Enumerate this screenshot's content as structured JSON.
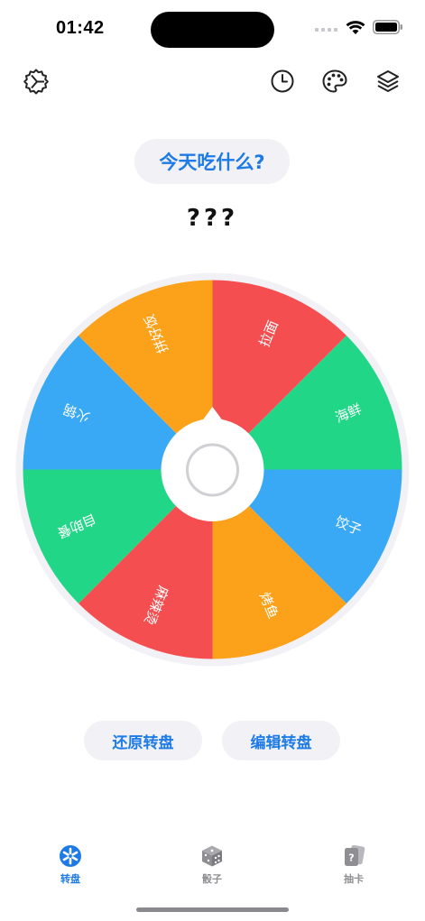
{
  "status": {
    "time": "01:42"
  },
  "header": {
    "title": "今天吃什么?",
    "result": "???"
  },
  "wheel": {
    "segments": [
      {
        "label": "拉面",
        "color": "#f54e50"
      },
      {
        "label": "海鲜",
        "color": "#22d687"
      },
      {
        "label": "饺子",
        "color": "#3aa9f5"
      },
      {
        "label": "烤鱼",
        "color": "#fba11a"
      },
      {
        "label": "麻辣烫",
        "color": "#f54e50"
      },
      {
        "label": "自助餐",
        "color": "#22d687"
      },
      {
        "label": "火锅",
        "color": "#3aa9f5"
      },
      {
        "label": "拼好饭",
        "color": "#fba11a"
      }
    ]
  },
  "actions": {
    "reset_label": "还原转盘",
    "edit_label": "编辑转盘"
  },
  "tabs": [
    {
      "label": "转盘",
      "active": true
    },
    {
      "label": "骰子",
      "active": false
    },
    {
      "label": "抽卡",
      "active": false
    }
  ],
  "colors": {
    "accent": "#1e7be6",
    "pill_bg": "#f1f1f6",
    "inactive": "#8e8e93"
  }
}
